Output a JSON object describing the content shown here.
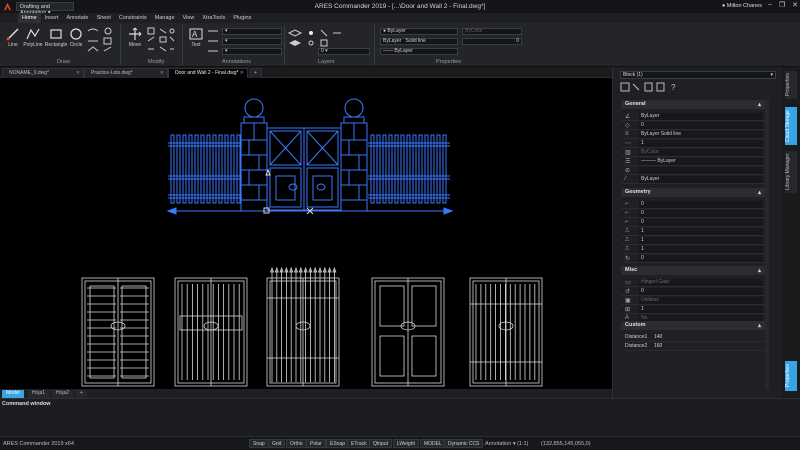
{
  "app": {
    "title": "ARES Commander 2019 - [...\\Door and Wall 2 - Final.dwg*]",
    "workspace": "Drafting and Annotation",
    "user": "Milton Chanes",
    "window_controls": [
      "–",
      "❐",
      "✕"
    ]
  },
  "menu": [
    "Home",
    "Insert",
    "Annotate",
    "Sheet",
    "Constraints",
    "Manage",
    "View",
    "XtraTools",
    "Plugins"
  ],
  "ribbon": {
    "draw": {
      "label": "Draw",
      "tools": [
        "Line",
        "PolyLine",
        "Rectangle",
        "Circle"
      ]
    },
    "modify": {
      "label": "Modify",
      "tools": [
        "Move"
      ]
    },
    "annotations": {
      "label": "Annotations",
      "tools": [
        "Text"
      ]
    },
    "layers": {
      "label": "Layers",
      "current": "0"
    },
    "properties": {
      "label": "Properties",
      "color": "ByLayer",
      "linestyle_bylayer": "ByLayer",
      "linestyle": "Solid line",
      "lineweight": "ByLayer",
      "bycolor": "ByColor",
      "lw_value": "0"
    }
  },
  "doc_tabs": [
    {
      "label": "NONAME_0.dwg*",
      "active": false
    },
    {
      "label": "Practice-Lots.dwg*",
      "active": false
    },
    {
      "label": "Door and Wall 2 - Final.dwg*",
      "active": true
    }
  ],
  "doc_tab_add": "+",
  "layout_tabs": [
    {
      "label": "Model",
      "active": true
    },
    {
      "label": "Hoja1",
      "active": false
    },
    {
      "label": "Hoja2",
      "active": false
    }
  ],
  "layout_add": "+",
  "command_window": {
    "title": "Command window"
  },
  "status": {
    "app": "ARES Commander 2019 x64",
    "toggles": [
      "Snap",
      "Grid",
      "Ortho",
      "Polar",
      "ESnap",
      "ETrack",
      "QInput",
      "LWeight",
      "MODEL",
      "Dynamic CCS"
    ],
    "annotation": "Annotation",
    "scale": "(1:1)",
    "coords": "(132,855,145,055,0)"
  },
  "panel": {
    "selector": "Block (1)",
    "general": {
      "title": "General",
      "rows": [
        {
          "value": "ByLayer"
        },
        {
          "value": "0"
        },
        {
          "value": "ByLayer     Solid line"
        },
        {
          "value": "1"
        },
        {
          "value": "ByColor",
          "dim": true
        },
        {
          "value": "——— ByLayer"
        },
        {
          "value": ""
        },
        {
          "value": "ByLayer"
        }
      ]
    },
    "geometry": {
      "title": "Geometry",
      "rows": [
        "0",
        "0",
        "0",
        "1",
        "1",
        "1",
        "0"
      ]
    },
    "misc": {
      "title": "Misc",
      "rows": [
        {
          "value": "Hinged Gate",
          "dim": true
        },
        {
          "value": "0"
        },
        {
          "value": "Unitless",
          "dim": true
        },
        {
          "value": "1"
        },
        {
          "value": "No",
          "dim": true
        }
      ]
    },
    "custom": {
      "title": "Custom",
      "rows": [
        {
          "label": "Distance1",
          "value": "140"
        },
        {
          "label": "Distance2",
          "value": "160"
        }
      ]
    }
  },
  "side_tabs": [
    "Properties",
    "Cloud Storage",
    "Library Manager",
    "Properties"
  ],
  "colors": {
    "accent": "#38a4e6",
    "selected_gate": "#3a78ff",
    "drawing": "#d8d8d8"
  }
}
